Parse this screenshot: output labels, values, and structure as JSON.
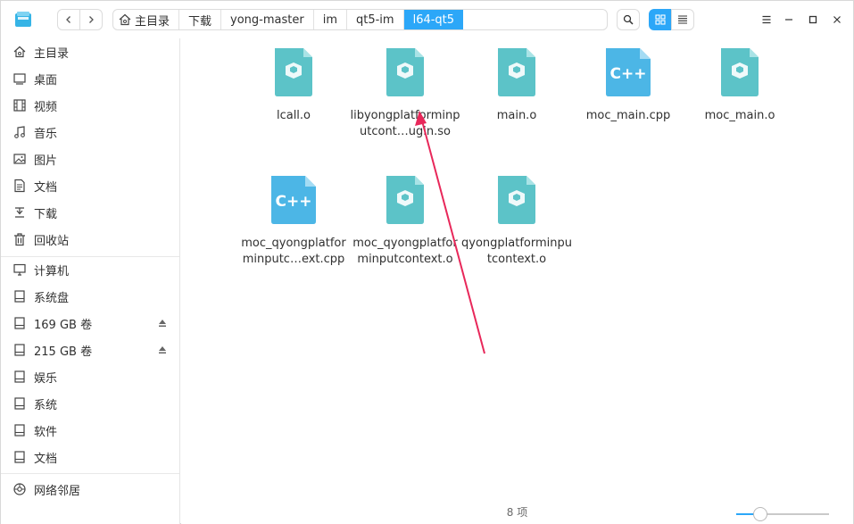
{
  "breadcrumb": {
    "home_label": "主目录",
    "segments": [
      "下载",
      "yong-master",
      "im",
      "qt5-im"
    ],
    "active": "l64-qt5"
  },
  "toolbar": {
    "back_icon": "chevron-left-icon",
    "forward_icon": "chevron-right-icon",
    "search_icon": "search-icon",
    "view_mode": "icon"
  },
  "sidebar": {
    "items": [
      {
        "label": "主目录",
        "icon": "home-icon"
      },
      {
        "label": "桌面",
        "icon": "desktop-icon"
      },
      {
        "label": "视频",
        "icon": "video-icon"
      },
      {
        "label": "音乐",
        "icon": "music-icon"
      },
      {
        "label": "图片",
        "icon": "picture-icon"
      },
      {
        "label": "文档",
        "icon": "document-icon"
      },
      {
        "label": "下载",
        "icon": "download-icon"
      },
      {
        "label": "回收站",
        "icon": "trash-icon"
      },
      {
        "label": "计算机",
        "icon": "computer-icon"
      },
      {
        "label": "系统盘",
        "icon": "disk-icon"
      },
      {
        "label": "169 GB 卷",
        "icon": "disk-icon",
        "ejectable": true
      },
      {
        "label": "215 GB 卷",
        "icon": "disk-icon",
        "ejectable": true
      },
      {
        "label": "娱乐",
        "icon": "disk-icon"
      },
      {
        "label": "系统",
        "icon": "disk-icon"
      },
      {
        "label": "软件",
        "icon": "disk-icon"
      },
      {
        "label": "文档",
        "icon": "disk-icon"
      },
      {
        "label": "网络邻居",
        "icon": "network-icon"
      }
    ]
  },
  "files": [
    {
      "name": "lcall.o",
      "type": "object"
    },
    {
      "name": "libyongplatforminputcont…ugin.so",
      "type": "object"
    },
    {
      "name": "main.o",
      "type": "object"
    },
    {
      "name": "moc_main.cpp",
      "type": "cpp"
    },
    {
      "name": "moc_main.o",
      "type": "object"
    },
    {
      "name": "moc_qyongplatforminputc…ext.cpp",
      "type": "cpp"
    },
    {
      "name": "moc_qyongplatforminputcontext.o",
      "type": "object"
    },
    {
      "name": "qyongplatforminputcontext.o",
      "type": "object"
    }
  ],
  "status": {
    "count_label": "8 项"
  },
  "zoom": {
    "level": 0.26
  },
  "colors": {
    "accent": "#2ca7f8",
    "object_file": "#5cc3c8",
    "cpp_file": "#4cb6e6",
    "annotation_arrow": "#e8285a"
  }
}
